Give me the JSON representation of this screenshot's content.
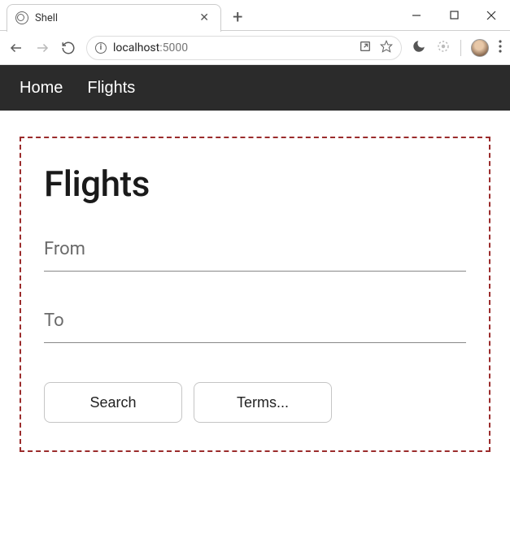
{
  "browser": {
    "tab_title": "Shell",
    "url_host": "localhost",
    "url_port": ":5000"
  },
  "nav": {
    "home": "Home",
    "flights": "Flights"
  },
  "page": {
    "title": "Flights",
    "from_label": "From",
    "to_label": "To",
    "search_label": "Search",
    "terms_label": "Terms..."
  }
}
